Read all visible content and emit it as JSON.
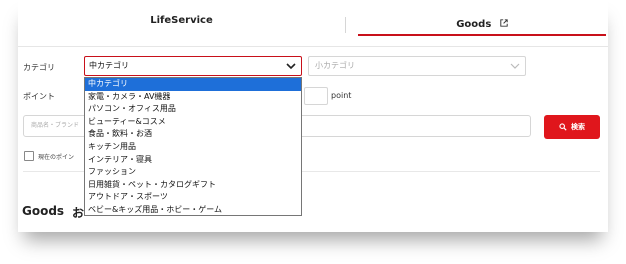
{
  "tabs": {
    "lifeservice_label": "LifeService",
    "goods_label": "Goods"
  },
  "filters": {
    "category_label": "カテゴリ",
    "category_selected": "中カテゴリ",
    "subcategory_placeholder": "小カテゴリ",
    "point_label": "ポイント",
    "point_unit": "point",
    "search_placeholder": "商品名・ブランド",
    "search_button_label": "検索",
    "checkbox_label": "現在のポイン"
  },
  "dropdown": {
    "options": [
      "中カテゴリ",
      "家電・カメラ・AV機器",
      "パソコン・オフィス用品",
      "ビューティー&コスメ",
      "食品・飲料・お酒",
      "キッチン用品",
      "インテリア・寝具",
      "ファッション",
      "日用雑貨・ペット・カタログギフト",
      "アウトドア・スポーツ",
      "ベビー&キッズ用品・ホビー・ゲーム"
    ],
    "selected_index": 0
  },
  "section": {
    "title": "Goods",
    "title_fragment": "お"
  },
  "colors": {
    "accent": "#e0161c",
    "tab_underline": "#c8101a",
    "selected_option": "#1e6fd9"
  },
  "icons": {
    "goods_tab_icon": "external-link-icon",
    "category_chevron": "chevron-down-icon",
    "subcategory_chevron": "chevron-down-icon",
    "search_button_icon": "search-icon"
  }
}
